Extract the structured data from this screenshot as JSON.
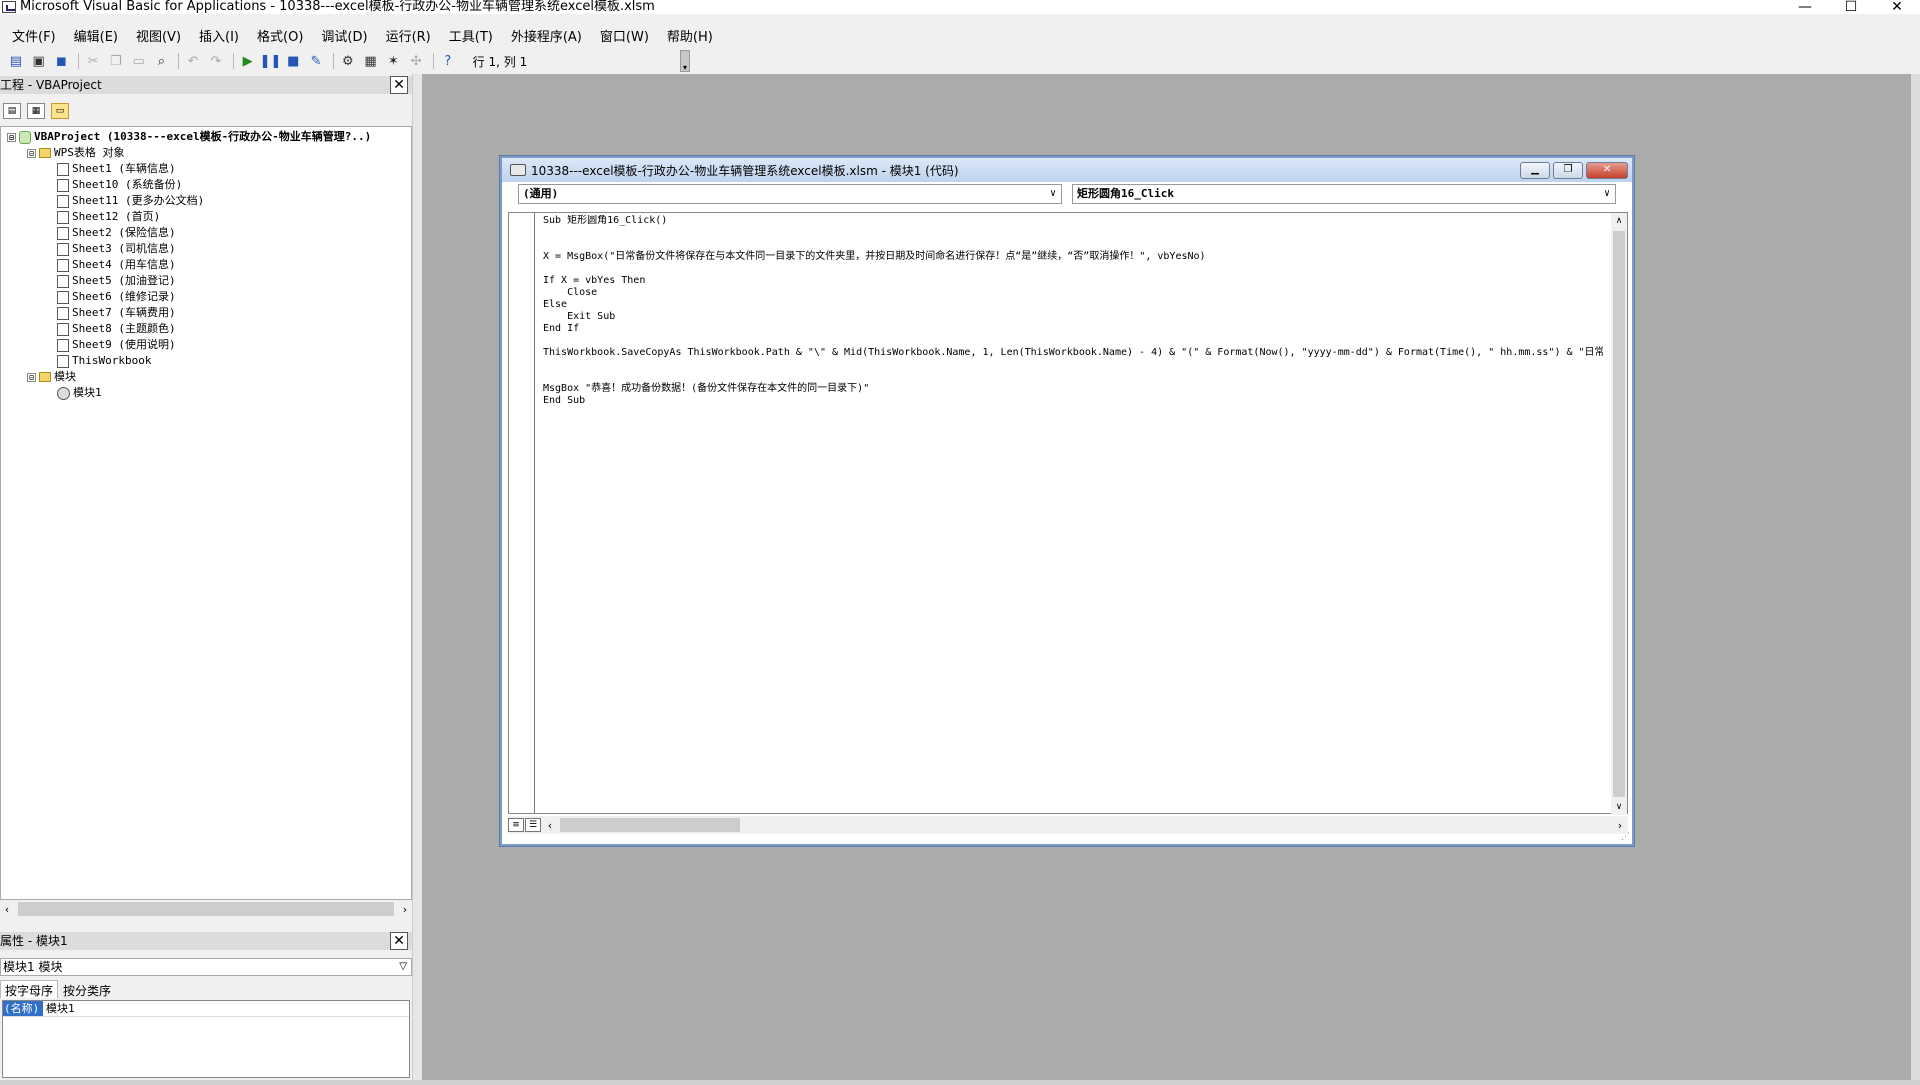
{
  "window": {
    "title": "Microsoft Visual Basic for Applications - 10338---excel模板-行政办公-物业车辆管理系统excel模板.xlsm",
    "minimize": "—",
    "maximize": "☐",
    "close": "✕"
  },
  "menu": [
    "文件(F)",
    "编辑(E)",
    "视图(V)",
    "插入(I)",
    "格式(O)",
    "调试(D)",
    "运行(R)",
    "工具(T)",
    "外接程序(A)",
    "窗口(W)",
    "帮助(H)"
  ],
  "toolbar": {
    "position": "行 1, 列 1"
  },
  "project_panel": {
    "title": "工程 - VBAProject",
    "close": "✕",
    "nodes": [
      {
        "label": "VBAProject (10338---excel模板-行政办公-物业车辆管理?..)",
        "expander": "⊟",
        "icon": "project-icon",
        "level": 0
      },
      {
        "label": "WPS表格 对象",
        "expander": "⊟",
        "icon": "folder-icon",
        "level": 1
      },
      {
        "label": "Sheet1 (车辆信息)",
        "icon": "sheet-icon",
        "level": 2
      },
      {
        "label": "Sheet10 (系统备份)",
        "icon": "sheet-icon",
        "level": 2
      },
      {
        "label": "Sheet11 (更多办公文档)",
        "icon": "sheet-icon",
        "level": 2
      },
      {
        "label": "Sheet12 (首页)",
        "icon": "sheet-icon",
        "level": 2
      },
      {
        "label": "Sheet2 (保险信息)",
        "icon": "sheet-icon",
        "level": 2
      },
      {
        "label": "Sheet3 (司机信息)",
        "icon": "sheet-icon",
        "level": 2
      },
      {
        "label": "Sheet4 (用车信息)",
        "icon": "sheet-icon",
        "level": 2
      },
      {
        "label": "Sheet5 (加油登记)",
        "icon": "sheet-icon",
        "level": 2
      },
      {
        "label": "Sheet6 (维修记录)",
        "icon": "sheet-icon",
        "level": 2
      },
      {
        "label": "Sheet7 (车辆费用)",
        "icon": "sheet-icon",
        "level": 2
      },
      {
        "label": "Sheet8 (主题颜色)",
        "icon": "sheet-icon",
        "level": 2
      },
      {
        "label": "Sheet9 (使用说明)",
        "icon": "sheet-icon",
        "level": 2
      },
      {
        "label": "ThisWorkbook",
        "icon": "sheet-icon",
        "level": 2
      },
      {
        "label": "模块",
        "expander": "⊟",
        "icon": "folder-icon",
        "level": 1
      },
      {
        "label": "模块1",
        "icon": "module-icon",
        "level": 2
      }
    ]
  },
  "properties_panel": {
    "title": "属性 - 模块1",
    "close": "✕",
    "object": "模块1 模块",
    "tabs": [
      "按字母序",
      "按分类序"
    ],
    "rows": [
      {
        "key": "(名称)",
        "value": "模块1"
      }
    ]
  },
  "code_window": {
    "title": "10338---excel模板-行政办公-物业车辆管理系统excel模板.xlsm - 模块1 (代码)",
    "object_combo": "(通用)",
    "procedure_combo": "矩形圆角16_Click",
    "lines": [
      "Sub 矩形圆角16_Click()",
      "",
      "",
      "X = MsgBox(\"日常备份文件将保存在与本文件同一目录下的文件夹里，并按日期及时间命名进行保存！点“是”继续，“否”取消操作！\", vbYesNo)",
      "",
      "If X = vbYes Then",
      "    Close",
      "Else",
      "    Exit Sub",
      "End If",
      "",
      "ThisWorkbook.SaveCopyAs ThisWorkbook.Path & \"\\\" & Mid(ThisWorkbook.Name, 1, Len(ThisWorkbook.Name) - 4) & \"(\" & Format(Now(), \"yyyy-mm-dd\") & Format(Time(), \" hh.mm.ss\") & \"日常备",
      "",
      "",
      "MsgBox \"恭喜！成功备份数据！(备份文件保存在本文件的同一目录下)\"",
      "End Sub"
    ]
  }
}
